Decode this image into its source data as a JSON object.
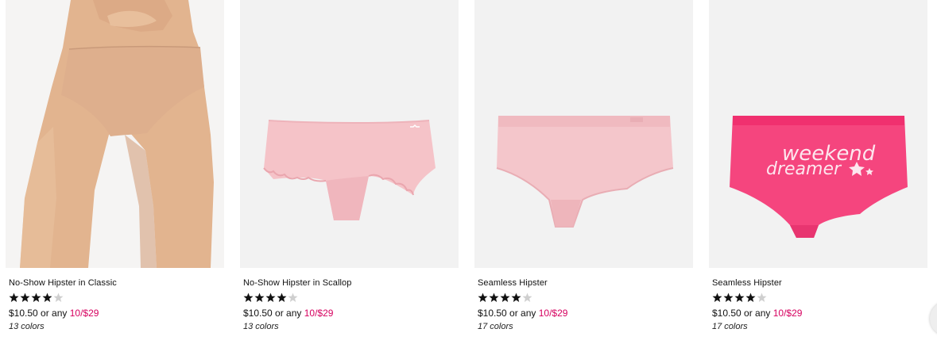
{
  "products": [
    {
      "name": "No-Show Hipster in Classic",
      "rating": 4,
      "price": "$10.50",
      "price_connector": "or any",
      "promo": "10/$29",
      "colors": "13 colors",
      "image": "model-wearing-nude-hipster"
    },
    {
      "name": "No-Show Hipster in Scallop",
      "rating": 4,
      "price": "$10.50",
      "price_connector": "or any",
      "promo": "10/$29",
      "colors": "13 colors",
      "image": "pink-scallop-hipster"
    },
    {
      "name": "Seamless Hipster",
      "rating": 4,
      "price": "$10.50",
      "price_connector": "or any",
      "promo": "10/$29",
      "colors": "17 colors",
      "image": "light-pink-seamless-hipster"
    },
    {
      "name": "Seamless Hipster",
      "rating": 4,
      "price": "$10.50",
      "price_connector": "or any",
      "promo": "10/$29",
      "colors": "17 colors",
      "image": "hot-pink-hipster-weekend-dreamer-print"
    }
  ],
  "print_text": {
    "line1": "weekend",
    "line2": "dreamer"
  },
  "colors": {
    "promo": "#d6005f",
    "tile_bg": "#f2f2f2",
    "hot_pink": "#f5457e",
    "light_pink": "#f6c7cc"
  }
}
